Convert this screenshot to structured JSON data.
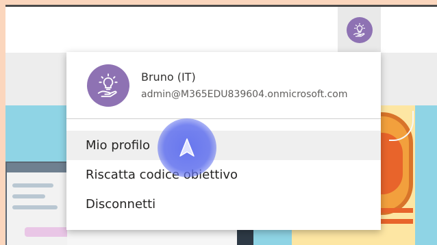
{
  "account": {
    "display_name": "Bruno (IT)",
    "email": "admin@M365EDU839604.onmicrosoft.com",
    "avatar_icon": "lightbulb-hand-icon",
    "avatar_color": "#8e72b3"
  },
  "menu": {
    "items": [
      {
        "label": "Mio profilo"
      },
      {
        "label": "Riscatta codice obiettivo"
      },
      {
        "label": "Disconnetti"
      }
    ]
  },
  "cursor": {
    "icon": "arrow-cursor-icon",
    "color": "#6070ee"
  }
}
